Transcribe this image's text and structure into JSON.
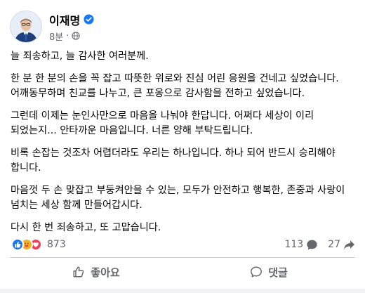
{
  "author": {
    "name": "이재명",
    "time": "8분",
    "verified": true,
    "privacy_icon": "globe-icon"
  },
  "post": {
    "paragraphs": [
      "늘 죄송하고, 늘 감사한 여러분께.",
      "한 분 한 분의 손을 꼭 잡고 따뜻한 위로와 진심 어린 응원을 건네고 싶었습니다. 어깨동무하며 친교를 나누고, 큰 포옹으로 감사함을 전하고 싶었습니다.",
      "그런데 이제는 눈인사만으로 마음을 나눠야 한답니다. 어쩌다 세상이 이리 되었는지... 안타까운 마음입니다. 너른 양해 부탁드립니다.",
      "비록 손잡는 것조차 어렵더라도 우리는 하나입니다. 하나 되어 반드시 승리해야 합니다.",
      "마음껏 두 손 맞잡고 부둥켜안을 수 있는, 모두가 안전하고 행복한, 존중과 사랑이 넘치는 세상 함께 만들어갑시다.",
      "다시 한 번 죄송하고, 또 고맙습니다."
    ]
  },
  "stats": {
    "reactions_count": "873",
    "reaction_icons": [
      "like-icon",
      "care-icon",
      "love-icon"
    ],
    "comments_count": "113",
    "shares_count": "27"
  },
  "actions": {
    "like_label": "좋아요",
    "comment_label": "댓글"
  },
  "colors": {
    "brand_blue": "#1877f2",
    "love_red": "#f33e58",
    "care_yellow": "#f7b125",
    "muted_text": "#65676b"
  }
}
